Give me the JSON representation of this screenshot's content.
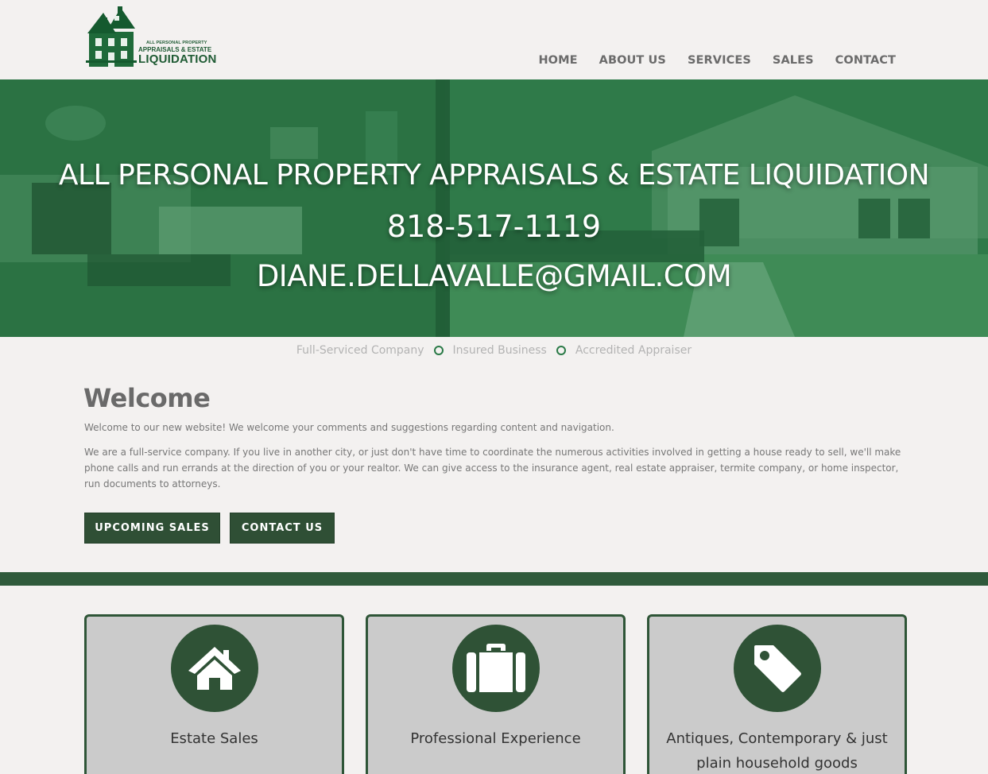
{
  "brand": {
    "logo_line1": "ALL PERSONAL PROPERTY",
    "logo_line2": "APPRAISALS & ESTATE",
    "logo_line3": "LIQUIDATION",
    "color_primary": "#2f5236",
    "color_hero": "#2e7a48"
  },
  "nav": {
    "items": [
      {
        "label": "HOME"
      },
      {
        "label": "ABOUT US"
      },
      {
        "label": "SERVICES"
      },
      {
        "label": "SALES"
      },
      {
        "label": "CONTACT"
      }
    ]
  },
  "hero": {
    "title": "ALL PERSONAL PROPERTY APPRAISALS & ESTATE LIQUIDATION",
    "phone": "818-517-1119",
    "email": "DIANE.DELLAVALLE@GMAIL.COM"
  },
  "taglines": [
    "Full-Serviced Company",
    "Insured Business",
    "Accredited Appraiser"
  ],
  "welcome": {
    "title": "Welcome",
    "paragraph1": "Welcome to our new website! We welcome your comments and suggestions regarding content and navigation.",
    "paragraph2": "We are a full-service company. If you live in another city, or just don't have time to coordinate the numerous activities involved in getting a house ready to sell, we'll make phone calls and run errands at the direction of you or your realtor. We can give access to the insurance agent, real estate appraiser, termite company, or home inspector, run documents to attorneys."
  },
  "buttons": {
    "upcoming_sales": "UPCOMING SALES",
    "contact_us": "CONTACT US"
  },
  "cards": [
    {
      "icon": "home-icon",
      "label": "Estate Sales"
    },
    {
      "icon": "briefcase-icon",
      "label": "Professional Experience"
    },
    {
      "icon": "tag-icon",
      "label": "Antiques, Contemporary & just plain household goods"
    }
  ]
}
